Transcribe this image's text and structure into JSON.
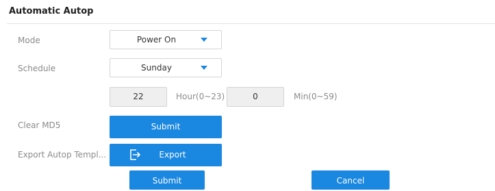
{
  "section": {
    "title": "Automatic Autop"
  },
  "mode": {
    "label": "Mode",
    "value": "Power On"
  },
  "schedule": {
    "label": "Schedule",
    "value": "Sunday"
  },
  "time": {
    "hour_value": "22",
    "hour_unit": "Hour(0~23)",
    "min_value": "0",
    "min_unit": "Min(0~59)"
  },
  "clear_md5": {
    "label": "Clear MD5",
    "button": "Submit"
  },
  "export_template": {
    "label": "Export Autop Templ...",
    "button": "Export",
    "icon": "export-icon"
  },
  "footer": {
    "submit": "Submit",
    "cancel": "Cancel"
  },
  "colors": {
    "accent": "#1a87e0",
    "label": "#8a8a8a",
    "input_disabled_bg": "#efefef"
  }
}
